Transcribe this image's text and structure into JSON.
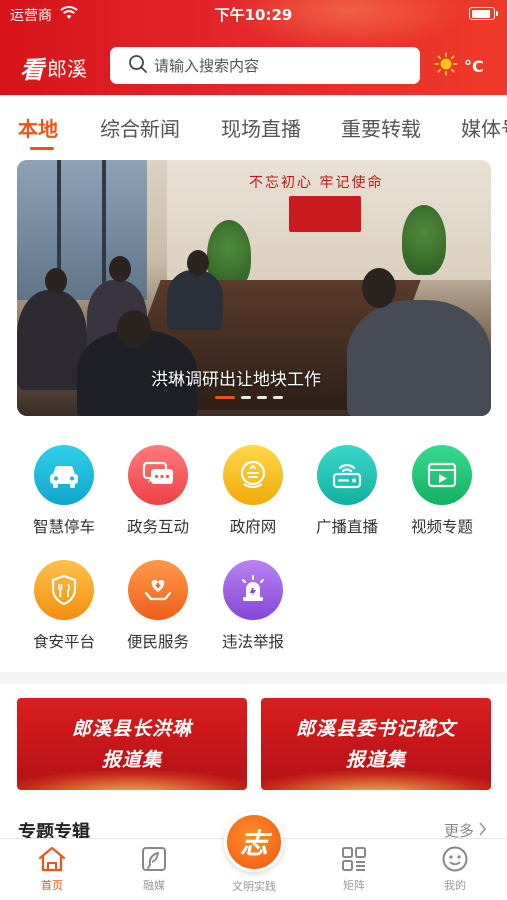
{
  "status_bar": {
    "carrier": "运营商",
    "time": "下午10:29",
    "battery_level": 0.9
  },
  "header": {
    "logo_mark": "看",
    "logo_name": "郎溪",
    "search_placeholder": "请输入搜索内容",
    "weather_unit": "°C",
    "icons": {
      "wifi": "wifi-icon",
      "search": "search-icon",
      "weather": "sun-icon"
    }
  },
  "tabs": [
    {
      "label": "本地",
      "active": true
    },
    {
      "label": "综合新闻",
      "active": false
    },
    {
      "label": "现场直播",
      "active": false
    },
    {
      "label": "重要转载",
      "active": false
    },
    {
      "label": "媒体号",
      "active": false
    }
  ],
  "banner": {
    "caption": "洪琳调研出让地块工作",
    "wall_slogan": "不忘初心 牢记使命",
    "page_count": 4,
    "active_page": 1
  },
  "services": [
    {
      "label": "智慧停车",
      "icon": "car-icon",
      "color": "#19b8d6"
    },
    {
      "label": "政务互动",
      "icon": "chat-icon",
      "color": "#f2585b"
    },
    {
      "label": "政府网",
      "icon": "emblem-icon",
      "color": "#f6bf1b"
    },
    {
      "label": "广播直播",
      "icon": "radio-icon",
      "color": "#1fc3b4"
    },
    {
      "label": "视频专题",
      "icon": "video-icon",
      "color": "#22c47a"
    },
    {
      "label": "食安平台",
      "icon": "food-safety-icon",
      "color": "#f6a61b"
    },
    {
      "label": "便民服务",
      "icon": "heart-hand-icon",
      "color": "#f2752a"
    },
    {
      "label": "违法举报",
      "icon": "alarm-icon",
      "color": "#9a5fe0"
    }
  ],
  "report_cards": [
    {
      "line1": "郎溪县长洪琳",
      "line2": "报道集"
    },
    {
      "line1": "郎溪县委书记嵇文",
      "line2": "报道集"
    }
  ],
  "section": {
    "title": "专题专辑",
    "more_label": "更多"
  },
  "bottom_nav": [
    {
      "label": "首页",
      "icon": "home-icon",
      "active": true
    },
    {
      "label": "融媒",
      "icon": "media-icon",
      "active": false
    },
    {
      "label": "文明实践",
      "icon": "volunteer-icon",
      "active": false,
      "center_glyph": "志"
    },
    {
      "label": "矩阵",
      "icon": "matrix-icon",
      "active": false
    },
    {
      "label": "我的",
      "icon": "profile-icon",
      "active": false
    }
  ],
  "colors": {
    "brand_red": "#d6141a",
    "accent_orange": "#e8561b",
    "inactive_gray": "#999999"
  }
}
